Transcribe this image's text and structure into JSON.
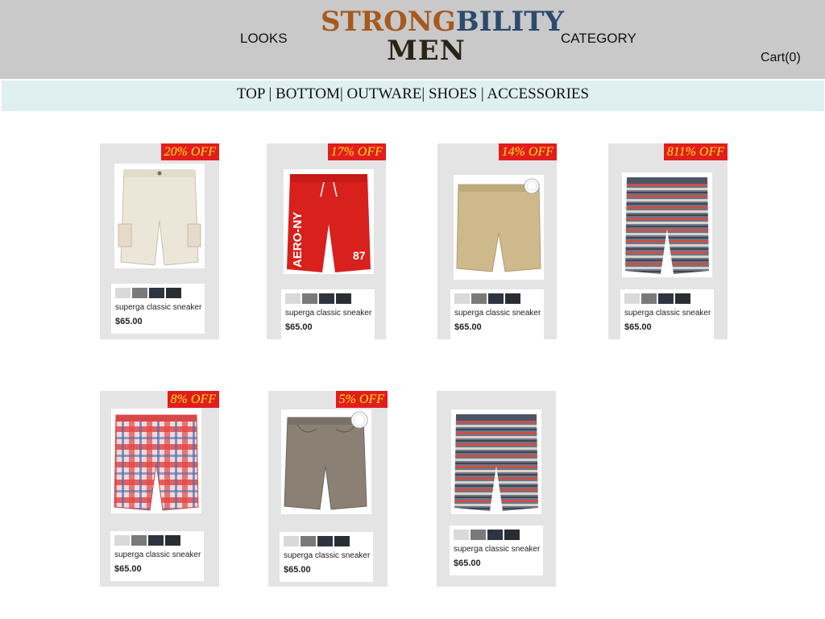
{
  "header": {
    "nav_left": "LOOKS",
    "nav_right": "CATEGORY",
    "logo_part1": "STRONG",
    "logo_part2": "BILITY",
    "logo_line2": "MEN",
    "cart": "Cart(0)"
  },
  "subnav": {
    "items": [
      "TOP",
      "BOTTOM",
      "OUTWARE",
      "SHOES",
      "ACCESSORIES"
    ],
    "separators": [
      " | ",
      "| ",
      "| ",
      " | "
    ]
  },
  "colors": {
    "header_bg": "#c9c9c9",
    "subnav_bg": "#dff0f2",
    "card_bg": "#e4e4e4",
    "badge_bg": "#e21d1d",
    "badge_text": "#ffe91a",
    "logo_orange": "#a65a1e",
    "logo_blue": "#2d4a6e"
  },
  "swatches": [
    "#d9d9d9",
    "#7a7a7a",
    "#2e3440",
    "#2a2e33"
  ],
  "products": [
    {
      "badge": "20% OFF",
      "name": "superga classic sneaker",
      "price": "$65.00",
      "image": "beige-cargo-shorts"
    },
    {
      "badge": "17% OFF",
      "name": "superga classic sneaker",
      "price": "$65.00",
      "image": "red-aero-ny-shorts"
    },
    {
      "badge": "14% OFF",
      "name": "superga classic sneaker",
      "price": "$65.00",
      "image": "khaki-shorts"
    },
    {
      "badge": "811% OFF",
      "name": "superga classic sneaker",
      "price": "$65.00",
      "image": "striped-shorts"
    },
    {
      "badge": "8% OFF",
      "name": "superga classic sneaker",
      "price": "$65.00",
      "image": "plaid-shorts"
    },
    {
      "badge": "5% OFF",
      "name": "superga classic sneaker",
      "price": "$65.00",
      "image": "gray-denim-shorts"
    },
    {
      "badge": "",
      "name": "superga classic sneaker",
      "price": "$65.00",
      "image": "striped-shorts"
    }
  ],
  "image_texts": {
    "red_print": "AERO-NY",
    "red_number": "87"
  }
}
